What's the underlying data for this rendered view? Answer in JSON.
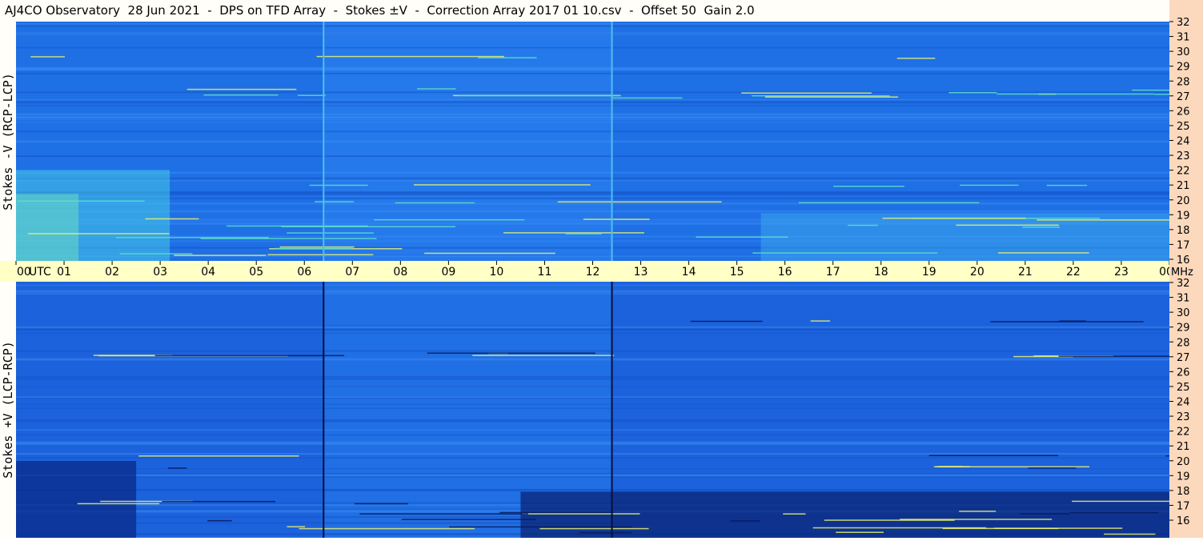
{
  "window": {
    "title": "AJ4CO Observatory  28 Jun 2021  -  DPS on TFD Array  -  Stokes ±V  -  Correction Array 2017 01 10.csv  -  Offset 50  Gain 2.0"
  },
  "panels": {
    "top_label": "Stokes -V (RCP-LCP)",
    "bottom_label": "Stokes +V (LCP-RCP)"
  },
  "colors": {
    "background_blue": "#1e6ee6",
    "warm_band": "#ffff80",
    "axis_bg": "#ffffc6",
    "right_axis_bg": "#fcd9bd"
  },
  "chart_data": {
    "type": "heatmap",
    "x_ticks": [
      "00",
      "01",
      "02",
      "03",
      "04",
      "05",
      "06",
      "07",
      "08",
      "09",
      "10",
      "11",
      "12",
      "13",
      "14",
      "15",
      "16",
      "17",
      "18",
      "19",
      "20",
      "21",
      "22",
      "23",
      "00"
    ],
    "x_unit": "UTC",
    "y_ticks": [
      "16",
      "17",
      "18",
      "19",
      "20",
      "21",
      "22",
      "23",
      "24",
      "25",
      "26",
      "27",
      "28",
      "29",
      "30",
      "31",
      "32"
    ],
    "y_unit": "MHz",
    "xlim": [
      0,
      24
    ],
    "ylim": [
      16,
      32
    ],
    "vertical_lines_hours": [
      6.4,
      12.4
    ]
  }
}
